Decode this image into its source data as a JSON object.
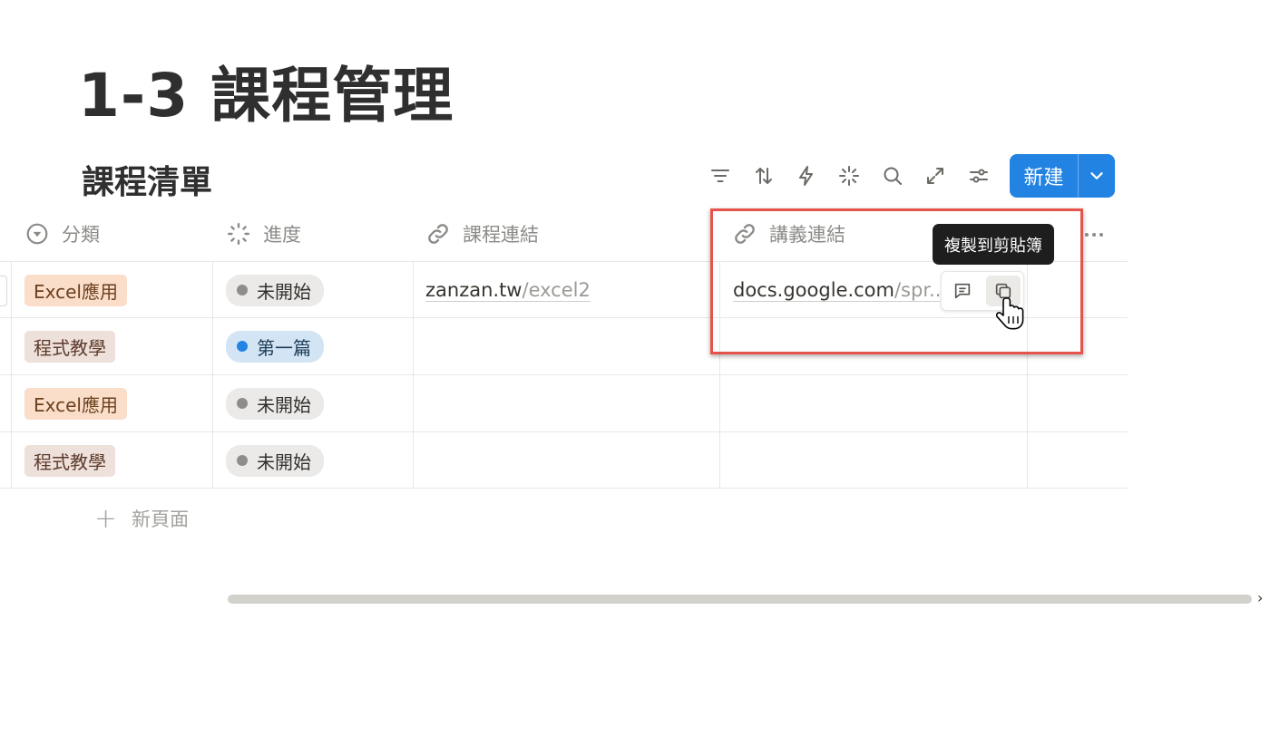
{
  "page": {
    "title": "1-3 課程管理"
  },
  "database": {
    "title": "課程清單",
    "toolbar": {
      "icons": [
        "filter-icon",
        "sort-icon",
        "automation-icon",
        "ai-icon",
        "search-icon",
        "expand-icon",
        "settings-icon"
      ],
      "new_label": "新建"
    },
    "columns": [
      {
        "label": "分類",
        "icon": "select-icon"
      },
      {
        "label": "進度",
        "icon": "status-icon"
      },
      {
        "label": "課程連結",
        "icon": "link-icon"
      },
      {
        "label": "講義連結",
        "icon": "link-icon"
      }
    ],
    "rows": [
      {
        "category": "Excel應用",
        "category_style": "excel",
        "status": "未開始",
        "status_style": "gray",
        "course_link": {
          "host": "zanzan.tw",
          "path": "/excel2"
        },
        "handout_link": {
          "host": "docs.google.com",
          "path": "/spr..."
        }
      },
      {
        "category": "程式教學",
        "category_style": "prog",
        "status": "第一篇",
        "status_style": "blue",
        "course_link": null,
        "handout_link": null
      },
      {
        "category": "Excel應用",
        "category_style": "excel",
        "status": "未開始",
        "status_style": "gray",
        "course_link": null,
        "handout_link": null
      },
      {
        "category": "程式教學",
        "category_style": "prog",
        "status": "未開始",
        "status_style": "gray",
        "course_link": null,
        "handout_link": null
      }
    ],
    "new_page_label": "新頁面",
    "tooltip": "複製到剪貼簿",
    "colors": {
      "accent": "#2383e2",
      "highlight": "#e5534b"
    }
  }
}
